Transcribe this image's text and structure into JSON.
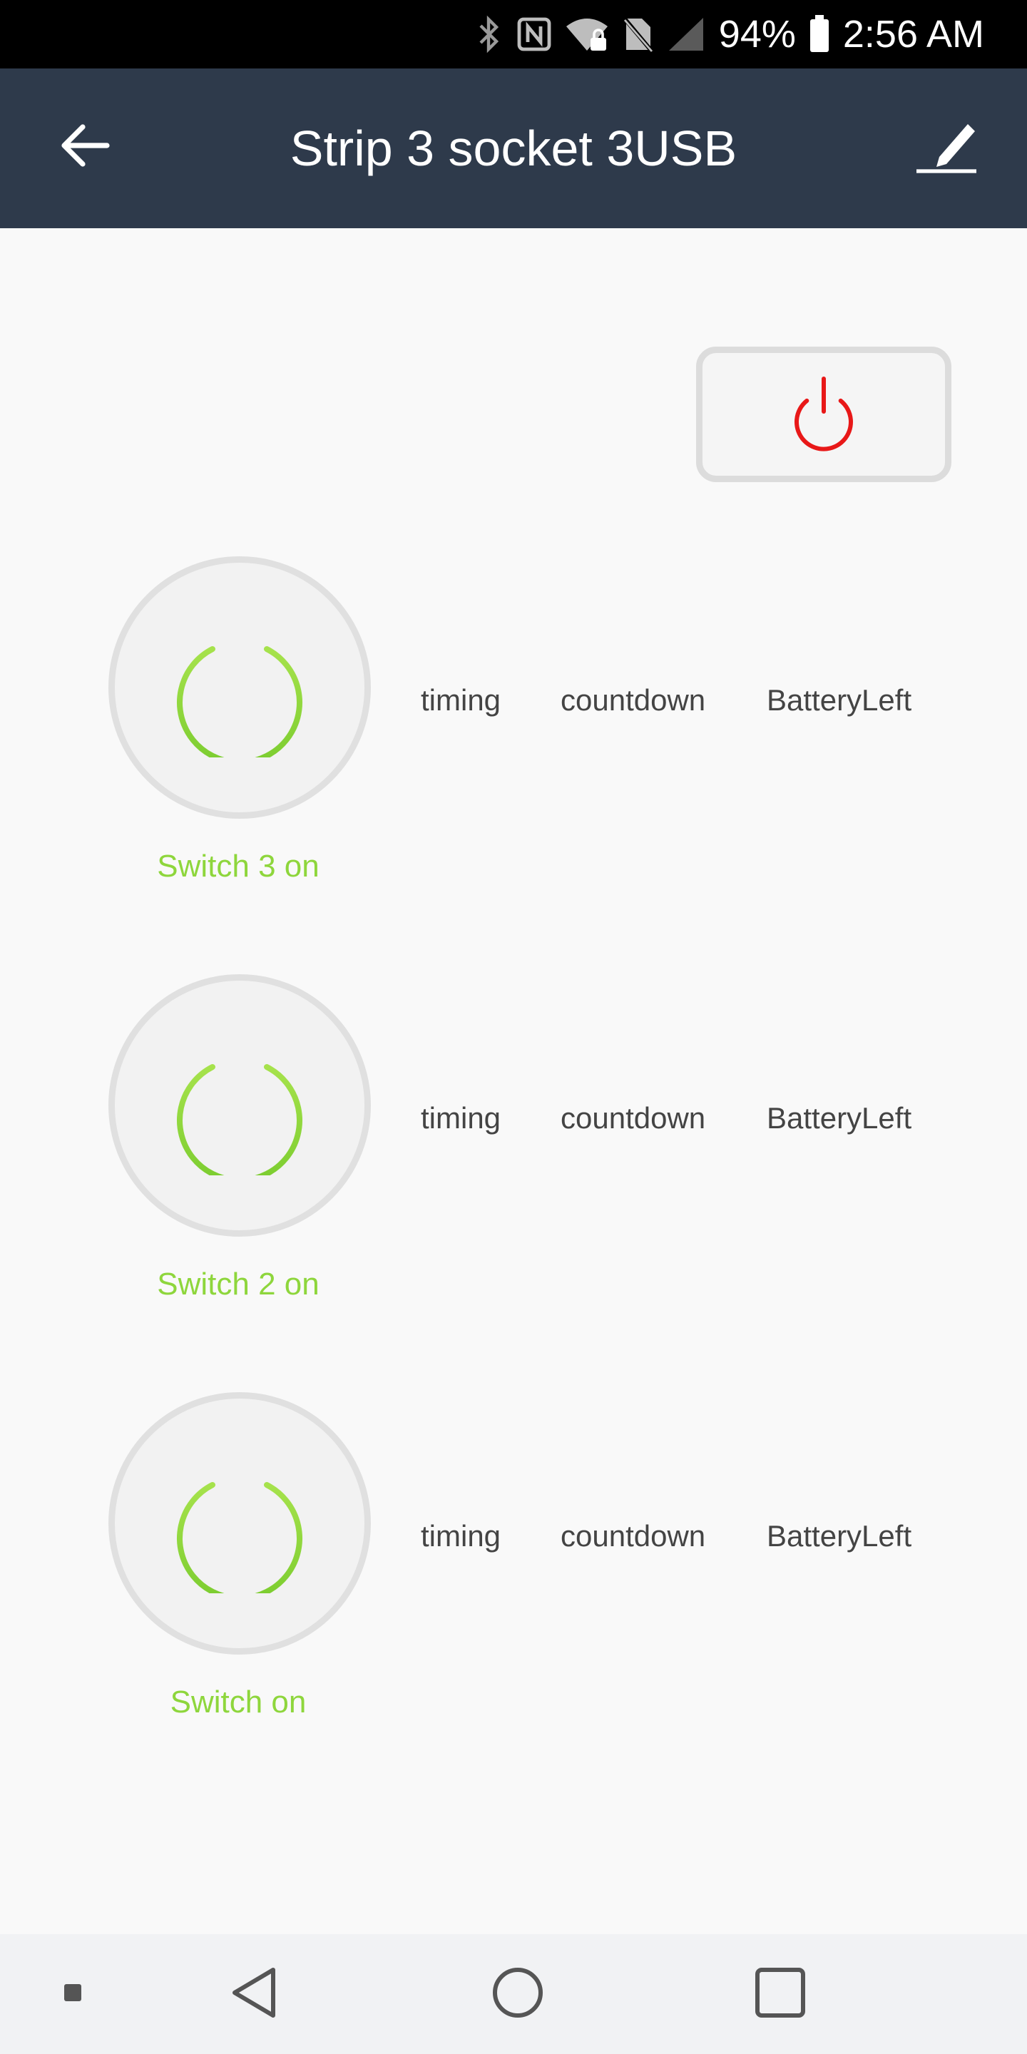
{
  "status_bar": {
    "battery_percent": "94%",
    "time": "2:56 AM"
  },
  "header": {
    "title": "Strip 3 socket 3USB"
  },
  "colors": {
    "header_bg": "#2e3a4b",
    "status_bg": "#000000",
    "on_green": "#8ed63c",
    "master_red": "#e81818"
  },
  "icons": {
    "back": "arrow-left-icon",
    "edit": "pencil-icon",
    "master": "power-icon",
    "switch": "power-icon"
  },
  "switches": [
    {
      "label": "Switch 3 on",
      "timing": "timing",
      "countdown": "countdown",
      "battery": "BatteryLeft"
    },
    {
      "label": "Switch 2 on",
      "timing": "timing",
      "countdown": "countdown",
      "battery": "BatteryLeft"
    },
    {
      "label": "Switch on",
      "timing": "timing",
      "countdown": "countdown",
      "battery": "BatteryLeft"
    }
  ]
}
